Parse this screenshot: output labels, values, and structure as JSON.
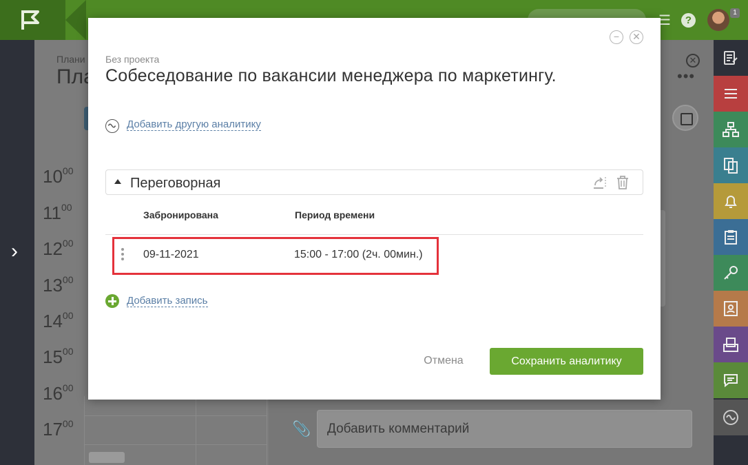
{
  "background": {
    "breadcrumb": "Плани",
    "title": "Пла",
    "hours": [
      {
        "h": "10",
        "m": "00"
      },
      {
        "h": "11",
        "m": "00"
      },
      {
        "h": "12",
        "m": "00"
      },
      {
        "h": "13",
        "m": "00"
      },
      {
        "h": "14",
        "m": "00"
      },
      {
        "h": "15",
        "m": "00"
      },
      {
        "h": "16",
        "m": "00"
      },
      {
        "h": "17",
        "m": "00"
      }
    ],
    "comment_placeholder": "Добавить комментарий",
    "avatar_badge": "1"
  },
  "modal": {
    "project": "Без проекта",
    "title": "Собеседование по вакансии менеджера по маркетингу.",
    "add_analytic_link": "Добавить другую аналитику",
    "section": {
      "name": "Переговорная",
      "columns": {
        "booked": "Забронирована",
        "period": "Период времени"
      },
      "rows": [
        {
          "booked": "09-11-2021",
          "period": "15:00 - 17:00 (2ч. 00мин.)"
        }
      ]
    },
    "add_record_link": "Добавить запись",
    "cancel_label": "Отмена",
    "save_label": "Сохранить аналитику"
  },
  "colors": {
    "topbar": "#4f8a25",
    "accent_green": "#6aa831",
    "link": "#5b7fa6",
    "highlight": "#e4323b",
    "rail": "#2d3039"
  },
  "right_rail": [
    {
      "icon": "edit-note-icon",
      "color": "#2d3039"
    },
    {
      "icon": "list-icon",
      "color": "#b83f3f"
    },
    {
      "icon": "hierarchy-icon",
      "color": "#3d8a5a"
    },
    {
      "icon": "documents-icon",
      "color": "#3a7f8f"
    },
    {
      "icon": "bell-icon",
      "color": "#b59a3a"
    },
    {
      "icon": "clipboard-icon",
      "color": "#3b6e95"
    },
    {
      "icon": "key-icon",
      "color": "#3d8a5a"
    },
    {
      "icon": "contact-card-icon",
      "color": "#b57a4a"
    },
    {
      "icon": "inbox-icon",
      "color": "#6a4a8a"
    },
    {
      "icon": "chat-icon",
      "color": "#5a8a3a"
    },
    {
      "icon": "analytics-wave-icon",
      "color": "#555555"
    }
  ]
}
